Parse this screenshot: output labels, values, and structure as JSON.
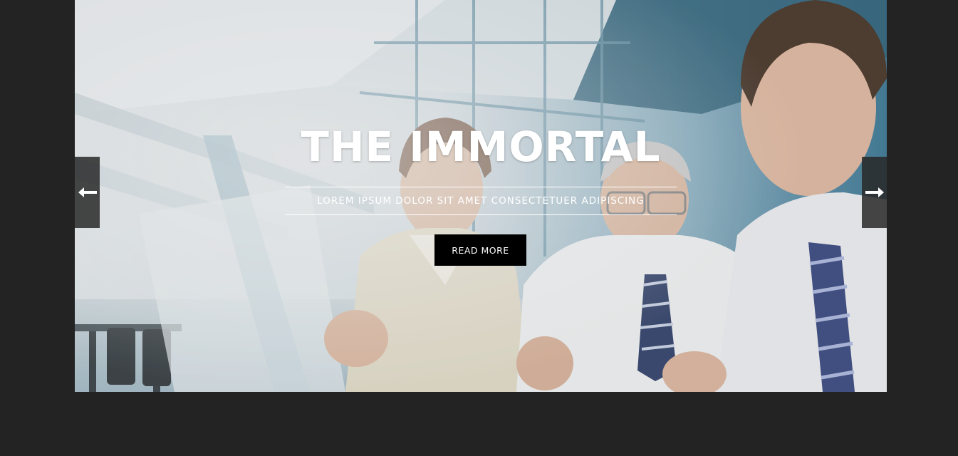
{
  "slider": {
    "title": "THE IMMORTAL",
    "subtitle": "LOREM IPSUM DOLOR SIT AMET CONSECTETUER ADIPISCING",
    "button_label": "READ MORE",
    "prev_icon": "arrow-left-icon",
    "next_icon": "arrow-right-icon"
  },
  "colors": {
    "page_background": "#232323",
    "button_background": "#000000",
    "text": "#ffffff",
    "arrow_background": "#282828"
  }
}
